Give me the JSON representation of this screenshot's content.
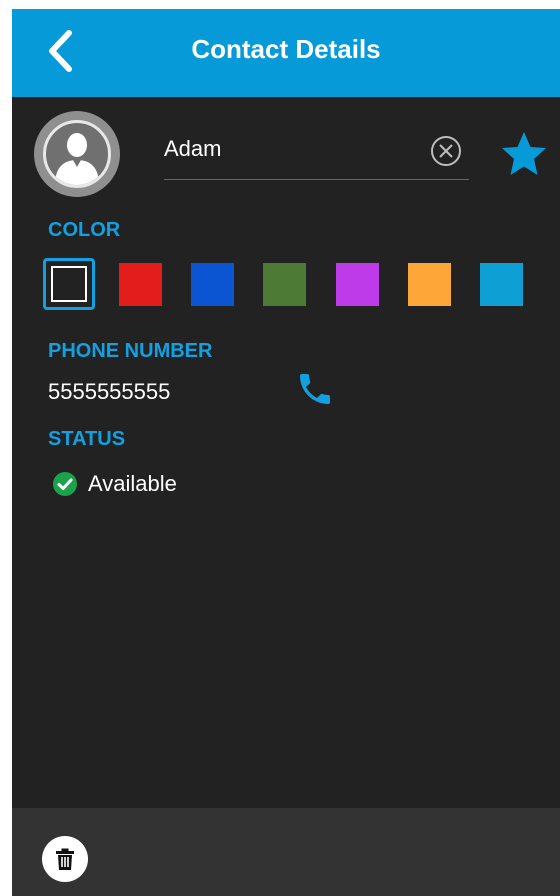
{
  "header": {
    "title": "Contact Details",
    "back_icon": "chevron-left-icon"
  },
  "contact": {
    "avatar_icon": "person-icon",
    "name": "Adam",
    "clear_icon": "clear-circle-icon",
    "favorite_icon": "star-icon",
    "favorite": true
  },
  "color_section": {
    "label": "COLOR",
    "swatches": [
      {
        "name": "none",
        "color": "#222222",
        "selected": true
      },
      {
        "name": "red",
        "color": "#e31d1c",
        "selected": false
      },
      {
        "name": "blue",
        "color": "#0c55d2",
        "selected": false
      },
      {
        "name": "green",
        "color": "#4d7b35",
        "selected": false
      },
      {
        "name": "purple",
        "color": "#be3be9",
        "selected": false
      },
      {
        "name": "orange",
        "color": "#fea637",
        "selected": false
      },
      {
        "name": "cyan",
        "color": "#0e9fd4",
        "selected": false
      }
    ]
  },
  "phone_section": {
    "label": "PHONE NUMBER",
    "number": "5555555555",
    "call_icon": "phone-icon"
  },
  "status_section": {
    "label": "STATUS",
    "value": "Available",
    "status_icon": "check-circle-icon",
    "status_color": "#1aa34a"
  },
  "footer": {
    "delete_icon": "trash-icon"
  },
  "theme": {
    "accent": "#069bd8",
    "background": "#222222",
    "footer_bg": "#333333"
  }
}
